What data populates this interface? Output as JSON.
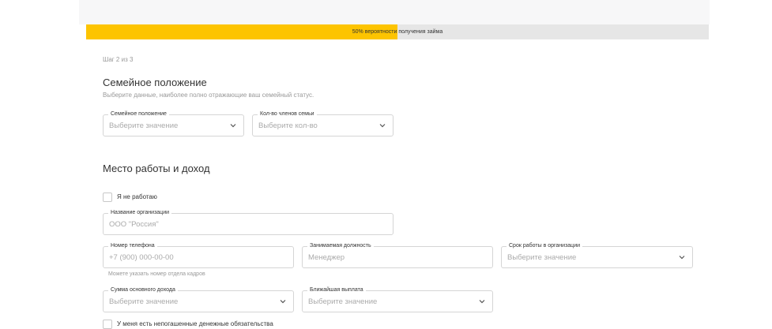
{
  "progress": {
    "text": "50% вероятности получения займа",
    "fraction": 0.5,
    "color": "#fdc400"
  },
  "step": "Шаг 2 из 3",
  "family": {
    "title": "Семейное положение",
    "subtitle": "Выберите данные, наиболее полно отражающие ваш семейный статус.",
    "status_field": {
      "label": "Семейное положение",
      "placeholder": "Выберите значение",
      "icon": "chevron-down-icon"
    },
    "members_field": {
      "label": "Кол-во членов семьи",
      "placeholder": "Выберите кол-во",
      "icon": "chevron-down-icon"
    }
  },
  "work": {
    "title": "Место работы и доход",
    "not_working_label": "Я не работаю",
    "org_field": {
      "label": "Название организации",
      "placeholder": "ООО \"Россия\""
    },
    "phone_field": {
      "label": "Номер телефона",
      "placeholder": "+7 (900) 000-00-00"
    },
    "phone_hint": "Можете указать номер отдела кадров",
    "position_field": {
      "label": "Занимаемая должность",
      "placeholder": "Менеджер"
    },
    "tenure_field": {
      "label": "Срок работы в организации",
      "placeholder": "Выберите значение",
      "icon": "chevron-down-icon"
    },
    "income_field": {
      "label": "Сумма основного дохода",
      "placeholder": "Выберите значение",
      "icon": "chevron-down-icon"
    },
    "payout_field": {
      "label": "Ближайшая выплата",
      "placeholder": "Выберите значение",
      "icon": "chevron-down-icon"
    },
    "obligations_label": "У меня есть непогашенные денежные обязательства"
  }
}
